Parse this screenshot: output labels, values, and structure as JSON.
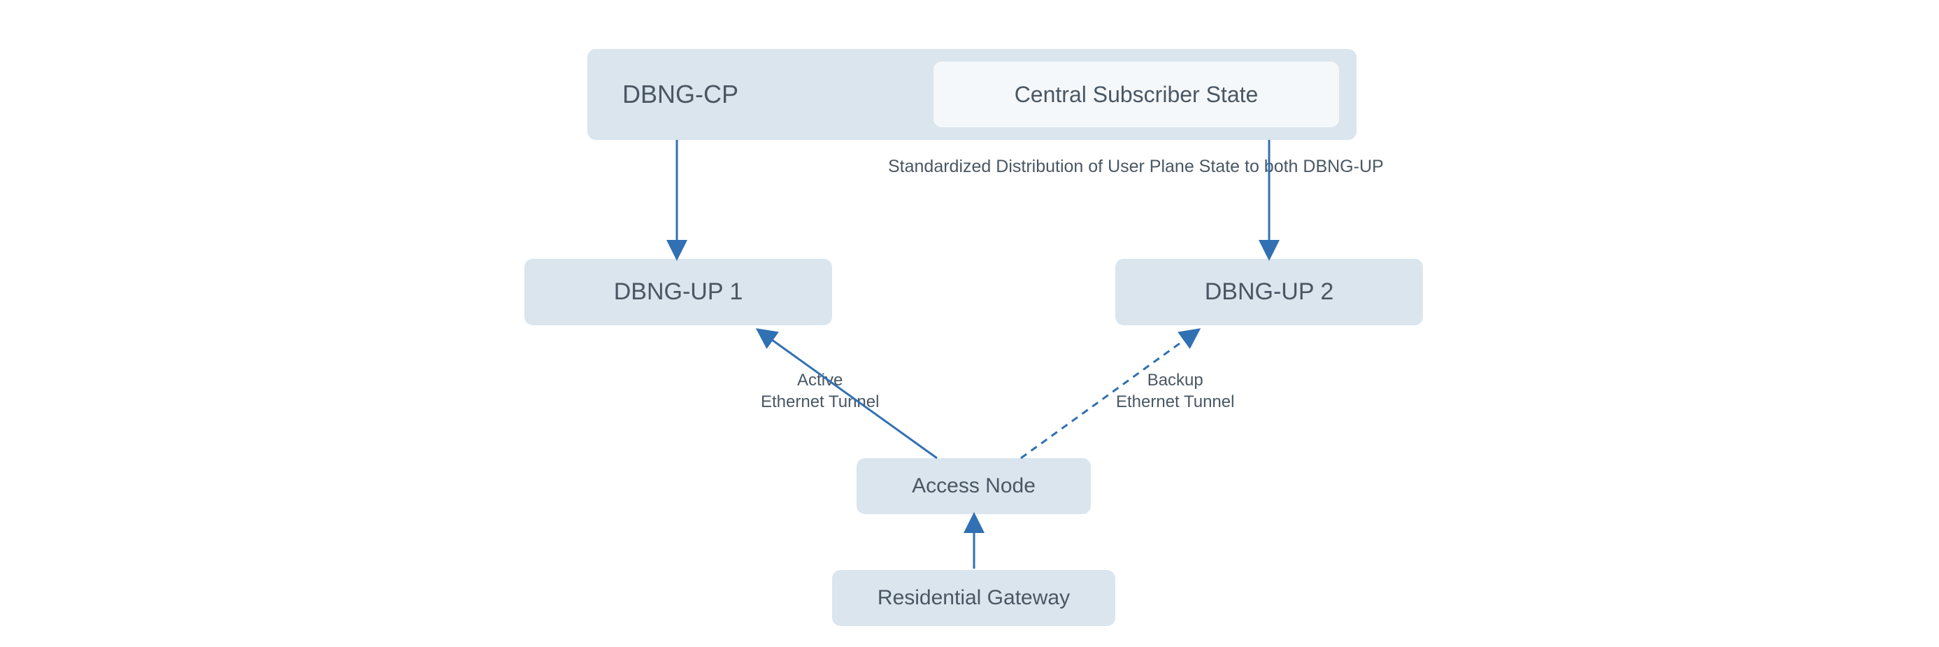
{
  "nodes": {
    "dbng_cp": "DBNG-CP",
    "central_state": "Central Subscriber State",
    "dbng_up1": "DBNG-UP 1",
    "dbng_up2": "DBNG-UP 2",
    "access_node": "Access Node",
    "residential_gateway": "Residential Gateway"
  },
  "labels": {
    "distribution": "Standardized Distribution of User Plane State to both DBNG-UP",
    "active_line1": "Active",
    "active_line2": "Ethernet Tunnel",
    "backup_line1": "Backup",
    "backup_line2": "Ethernet Tunnel"
  },
  "colors": {
    "box_bg": "#dae5ee",
    "inner_box_bg": "#f5f8fa",
    "text": "#4a5763",
    "arrow": "#3070b3"
  }
}
